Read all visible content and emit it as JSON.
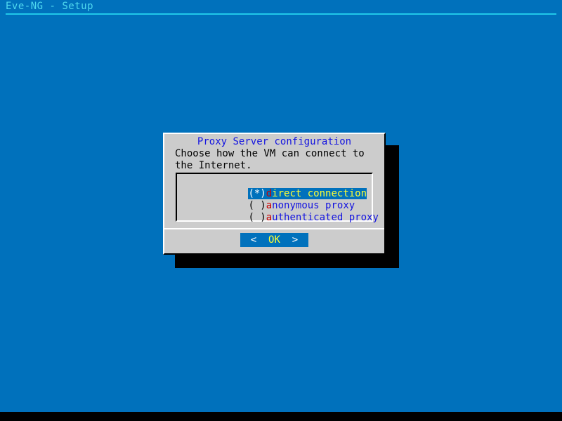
{
  "screen": {
    "background_color": "#0071bc",
    "bottom_strip_color": "#000000"
  },
  "titlebar": {
    "title": "Eve-NG - Setup",
    "text_color": "#4fd9ef",
    "rule_color": "#20c8e8"
  },
  "dialog": {
    "title": "Proxy Server configuration",
    "title_color": "#1414e0",
    "background_color": "#cccccc",
    "body_text": "Choose how the VM can connect to the Internet.",
    "listbox": {
      "options": [
        {
          "marker": "(*)",
          "hotkey": "d",
          "rest": "irect connection",
          "full_label": "direct connection",
          "selected": true
        },
        {
          "marker": "( )",
          "hotkey": "a",
          "rest": "nonymous proxy",
          "full_label": "anonymous proxy",
          "selected": false
        },
        {
          "marker": "( )",
          "hotkey": "a",
          "rest": "uthenticated proxy",
          "full_label": "authenticated proxy",
          "selected": false
        }
      ],
      "selected_index": 0,
      "highlight_color": "#0071bc",
      "selected_text_color": "#ffff33",
      "hotkey_color": "#cc0000",
      "option_text_color": "#1414e0"
    },
    "buttons": {
      "ok": {
        "left_arrow": "<",
        "label": "OK",
        "right_arrow": ">",
        "focused": true,
        "background_color": "#0071bc",
        "label_color": "#ffff33",
        "arrow_color": "#ffffff"
      }
    }
  }
}
